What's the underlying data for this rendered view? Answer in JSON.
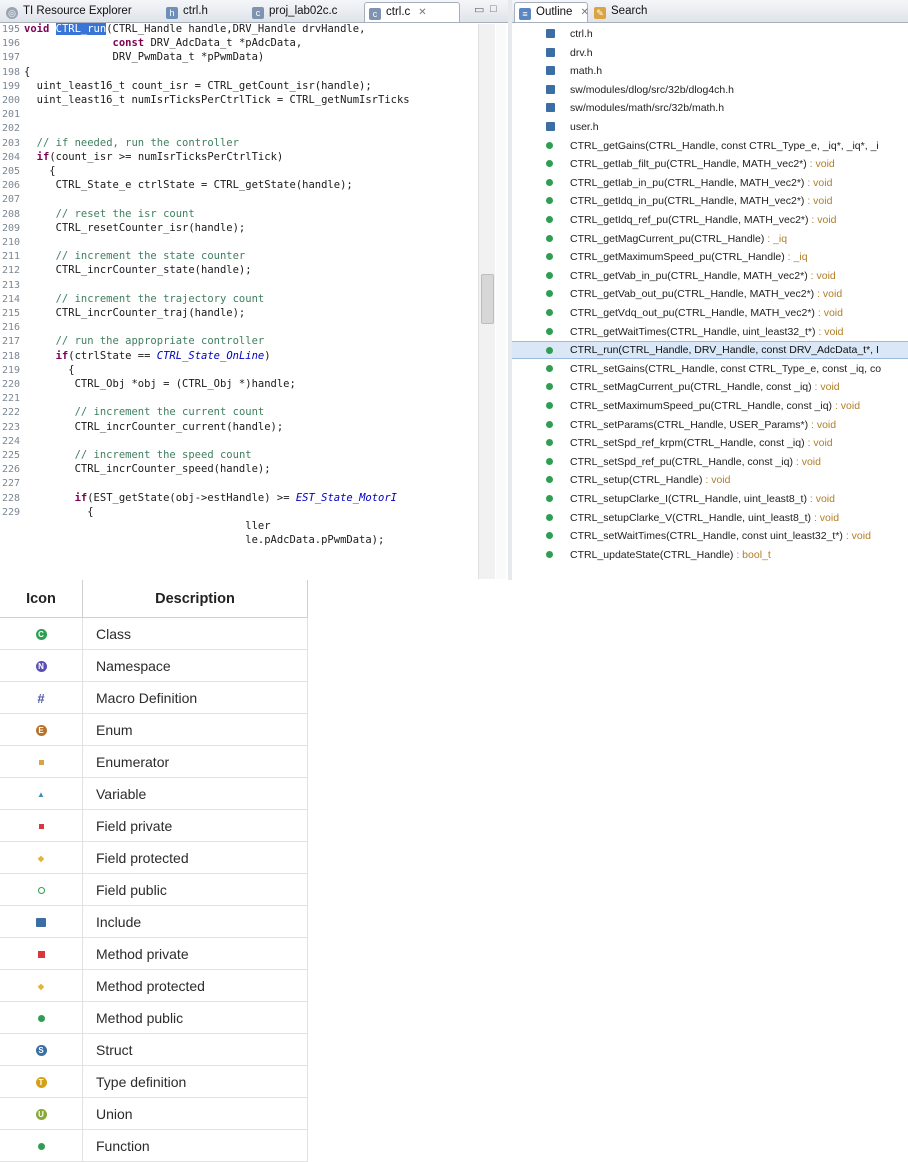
{
  "editor": {
    "tabs": [
      {
        "label": "TI Resource Explorer",
        "icon": "ti-explorer-icon"
      },
      {
        "label": "ctrl.h",
        "icon": "header-file-icon"
      },
      {
        "label": "proj_lab02c.c",
        "icon": "c-file-icon"
      },
      {
        "label": "ctrl.c",
        "icon": "c-file-icon",
        "close": "✕"
      }
    ],
    "minimize": "▭",
    "maximize": "□",
    "lines": [
      {
        "n": "195",
        "html": "<span class=\"kw\">void</span> <span class=\"sel\">CTRL_run</span>(CTRL_Handle handle,DRV_Handle drvHandle,"
      },
      {
        "n": "196",
        "html": "              <span class=\"kw\">const</span> DRV_AdcData_t *pAdcData,"
      },
      {
        "n": "197",
        "html": "              DRV_PwmData_t *pPwmData)"
      },
      {
        "n": "198",
        "html": "{"
      },
      {
        "n": "199",
        "html": "  uint_least16_t count_isr = CTRL_getCount_isr(handle);"
      },
      {
        "n": "200",
        "html": "  uint_least16_t numIsrTicksPerCtrlTick = CTRL_getNumIsrTicks"
      },
      {
        "n": "201",
        "html": ""
      },
      {
        "n": "202",
        "html": ""
      },
      {
        "n": "203",
        "html": "  <span class=\"cm\">// if needed, run the controller</span>"
      },
      {
        "n": "204",
        "html": "  <span class=\"kw\">if</span>(count_isr >= numIsrTicksPerCtrlTick)"
      },
      {
        "n": "205",
        "html": "    {"
      },
      {
        "n": "206",
        "html": "     CTRL_State_e ctrlState = CTRL_getState(handle);"
      },
      {
        "n": "207",
        "html": ""
      },
      {
        "n": "208",
        "html": "     <span class=\"cm\">// reset the isr count</span>"
      },
      {
        "n": "209",
        "html": "     CTRL_resetCounter_isr(handle);"
      },
      {
        "n": "210",
        "html": ""
      },
      {
        "n": "211",
        "html": "     <span class=\"cm\">// increment the state counter</span>"
      },
      {
        "n": "212",
        "html": "     CTRL_incrCounter_state(handle);"
      },
      {
        "n": "213",
        "html": ""
      },
      {
        "n": "214",
        "html": "     <span class=\"cm\">// increment the trajectory count</span>"
      },
      {
        "n": "215",
        "html": "     CTRL_incrCounter_traj(handle);"
      },
      {
        "n": "216",
        "html": ""
      },
      {
        "n": "217",
        "html": "     <span class=\"cm\">// run the appropriate controller</span>"
      },
      {
        "n": "218",
        "html": "     <span class=\"kw\">if</span>(ctrlState == <span class=\"en\">CTRL_State_OnLine</span>)"
      },
      {
        "n": "219",
        "html": "       {"
      },
      {
        "n": "220",
        "html": "        CTRL_Obj *obj = (CTRL_Obj *)handle;"
      },
      {
        "n": "221",
        "html": ""
      },
      {
        "n": "222",
        "html": "        <span class=\"cm\">// increment the current count</span>"
      },
      {
        "n": "223",
        "html": "        CTRL_incrCounter_current(handle);"
      },
      {
        "n": "224",
        "html": ""
      },
      {
        "n": "225",
        "html": "        <span class=\"cm\">// increment the speed count</span>"
      },
      {
        "n": "226",
        "html": "        CTRL_incrCounter_speed(handle);"
      },
      {
        "n": "227",
        "html": ""
      },
      {
        "n": "228",
        "html": "        <span class=\"kw\">if</span>(EST_getState(obj->estHandle) >= <span class=\"en\">EST_State_MotorI</span>"
      },
      {
        "n": "229",
        "html": "          {"
      }
    ],
    "overlap_lines": [
      {
        "n": "",
        "html": "                                   ller"
      },
      {
        "n": "",
        "html": "                                   le.pAdcData.pPwmData);"
      }
    ]
  },
  "outline": {
    "tabs": [
      {
        "label": "Outline",
        "icon": "outline-icon",
        "close": "✕"
      },
      {
        "label": "Search",
        "icon": "search-icon"
      }
    ],
    "items": [
      {
        "type": "include",
        "text": "ctrl.h",
        "ret": ""
      },
      {
        "type": "include",
        "text": "drv.h",
        "ret": ""
      },
      {
        "type": "include",
        "text": "math.h",
        "ret": ""
      },
      {
        "type": "include",
        "text": "sw/modules/dlog/src/32b/dlog4ch.h",
        "ret": ""
      },
      {
        "type": "include",
        "text": "sw/modules/math/src/32b/math.h",
        "ret": ""
      },
      {
        "type": "include",
        "text": "user.h",
        "ret": ""
      },
      {
        "type": "method",
        "text": "CTRL_getGains(CTRL_Handle, const CTRL_Type_e, _iq*, _iq*, _i",
        "ret": ""
      },
      {
        "type": "method",
        "text": "CTRL_getIab_filt_pu(CTRL_Handle, MATH_vec2*)",
        "ret": " : void"
      },
      {
        "type": "method",
        "text": "CTRL_getIab_in_pu(CTRL_Handle, MATH_vec2*)",
        "ret": " : void"
      },
      {
        "type": "method",
        "text": "CTRL_getIdq_in_pu(CTRL_Handle, MATH_vec2*)",
        "ret": " : void"
      },
      {
        "type": "method",
        "text": "CTRL_getIdq_ref_pu(CTRL_Handle, MATH_vec2*)",
        "ret": " : void"
      },
      {
        "type": "method",
        "text": "CTRL_getMagCurrent_pu(CTRL_Handle)",
        "ret": " : _iq"
      },
      {
        "type": "method",
        "text": "CTRL_getMaximumSpeed_pu(CTRL_Handle)",
        "ret": " : _iq"
      },
      {
        "type": "method",
        "text": "CTRL_getVab_in_pu(CTRL_Handle, MATH_vec2*)",
        "ret": " : void"
      },
      {
        "type": "method",
        "text": "CTRL_getVab_out_pu(CTRL_Handle, MATH_vec2*)",
        "ret": " : void"
      },
      {
        "type": "method",
        "text": "CTRL_getVdq_out_pu(CTRL_Handle, MATH_vec2*)",
        "ret": " : void"
      },
      {
        "type": "method",
        "text": "CTRL_getWaitTimes(CTRL_Handle, uint_least32_t*)",
        "ret": " : void"
      },
      {
        "type": "method",
        "text": "CTRL_run(CTRL_Handle, DRV_Handle, const DRV_AdcData_t*, I",
        "ret": "",
        "selected": true
      },
      {
        "type": "method",
        "text": "CTRL_setGains(CTRL_Handle, const CTRL_Type_e, const _iq, co",
        "ret": ""
      },
      {
        "type": "method",
        "text": "CTRL_setMagCurrent_pu(CTRL_Handle, const _iq)",
        "ret": " : void"
      },
      {
        "type": "method",
        "text": "CTRL_setMaximumSpeed_pu(CTRL_Handle, const _iq)",
        "ret": " : void"
      },
      {
        "type": "method",
        "text": "CTRL_setParams(CTRL_Handle, USER_Params*)",
        "ret": " : void"
      },
      {
        "type": "method",
        "text": "CTRL_setSpd_ref_krpm(CTRL_Handle, const _iq)",
        "ret": " : void"
      },
      {
        "type": "method",
        "text": "CTRL_setSpd_ref_pu(CTRL_Handle, const _iq)",
        "ret": " : void"
      },
      {
        "type": "method",
        "text": "CTRL_setup(CTRL_Handle)",
        "ret": " : void"
      },
      {
        "type": "method",
        "text": "CTRL_setupClarke_I(CTRL_Handle, uint_least8_t)",
        "ret": " : void"
      },
      {
        "type": "method",
        "text": "CTRL_setupClarke_V(CTRL_Handle, uint_least8_t)",
        "ret": " : void"
      },
      {
        "type": "method",
        "text": "CTRL_setWaitTimes(CTRL_Handle, const uint_least32_t*)",
        "ret": " : void"
      },
      {
        "type": "method",
        "text": "CTRL_updateState(CTRL_Handle)",
        "ret": " : bool_t"
      }
    ]
  },
  "legend": {
    "header_icon": "Icon",
    "header_desc": "Description",
    "rows": [
      {
        "icon": "class-icon",
        "kind": "circle",
        "color": "#2e9e52",
        "glyph": "C",
        "label": "Class"
      },
      {
        "icon": "namespace-icon",
        "kind": "circle",
        "color": "#5b4fb3",
        "glyph": "N",
        "label": "Namespace"
      },
      {
        "icon": "macro-icon",
        "kind": "hash",
        "color": "#4d5aa8",
        "glyph": "#",
        "label": "Macro Definition"
      },
      {
        "icon": "enum-icon",
        "kind": "circle",
        "color": "#b8732a",
        "glyph": "E",
        "label": "Enum"
      },
      {
        "icon": "enumerator-icon",
        "kind": "smallsq",
        "color": "#d9a441",
        "glyph": "",
        "label": "Enumerator"
      },
      {
        "icon": "variable-icon",
        "kind": "tri",
        "color": "#3a8fb7",
        "glyph": "▲",
        "label": "Variable"
      },
      {
        "icon": "field-private-icon",
        "kind": "smallsq",
        "color": "#d9363e",
        "glyph": "",
        "label": "Field private"
      },
      {
        "icon": "field-protected-icon",
        "kind": "diamond",
        "color": "#e4b33a",
        "glyph": "◆",
        "label": "Field protected"
      },
      {
        "icon": "field-public-icon",
        "kind": "smallci",
        "color": "#2e9e52",
        "glyph": "",
        "label": "Field public"
      },
      {
        "icon": "include-icon",
        "kind": "inc",
        "color": "#3a6ea5",
        "glyph": "",
        "label": "Include"
      },
      {
        "icon": "method-private-icon",
        "kind": "bigsq",
        "color": "#d9363e",
        "glyph": "",
        "label": "Method private"
      },
      {
        "icon": "method-protected-icon",
        "kind": "diamond",
        "color": "#e4b33a",
        "glyph": "◆",
        "label": "Method protected"
      },
      {
        "icon": "method-public-icon",
        "kind": "dot",
        "color": "#2e9e52",
        "glyph": "",
        "label": "Method public"
      },
      {
        "icon": "struct-icon",
        "kind": "circle",
        "color": "#3a6ea5",
        "glyph": "S",
        "label": "Struct"
      },
      {
        "icon": "typedef-icon",
        "kind": "circle",
        "color": "#d4a017",
        "glyph": "T",
        "label": "Type definition"
      },
      {
        "icon": "union-icon",
        "kind": "circle",
        "color": "#8aa83a",
        "glyph": "U",
        "label": "Union"
      },
      {
        "icon": "function-icon",
        "kind": "dot",
        "color": "#2e9e52",
        "glyph": "",
        "label": "Function"
      }
    ]
  }
}
